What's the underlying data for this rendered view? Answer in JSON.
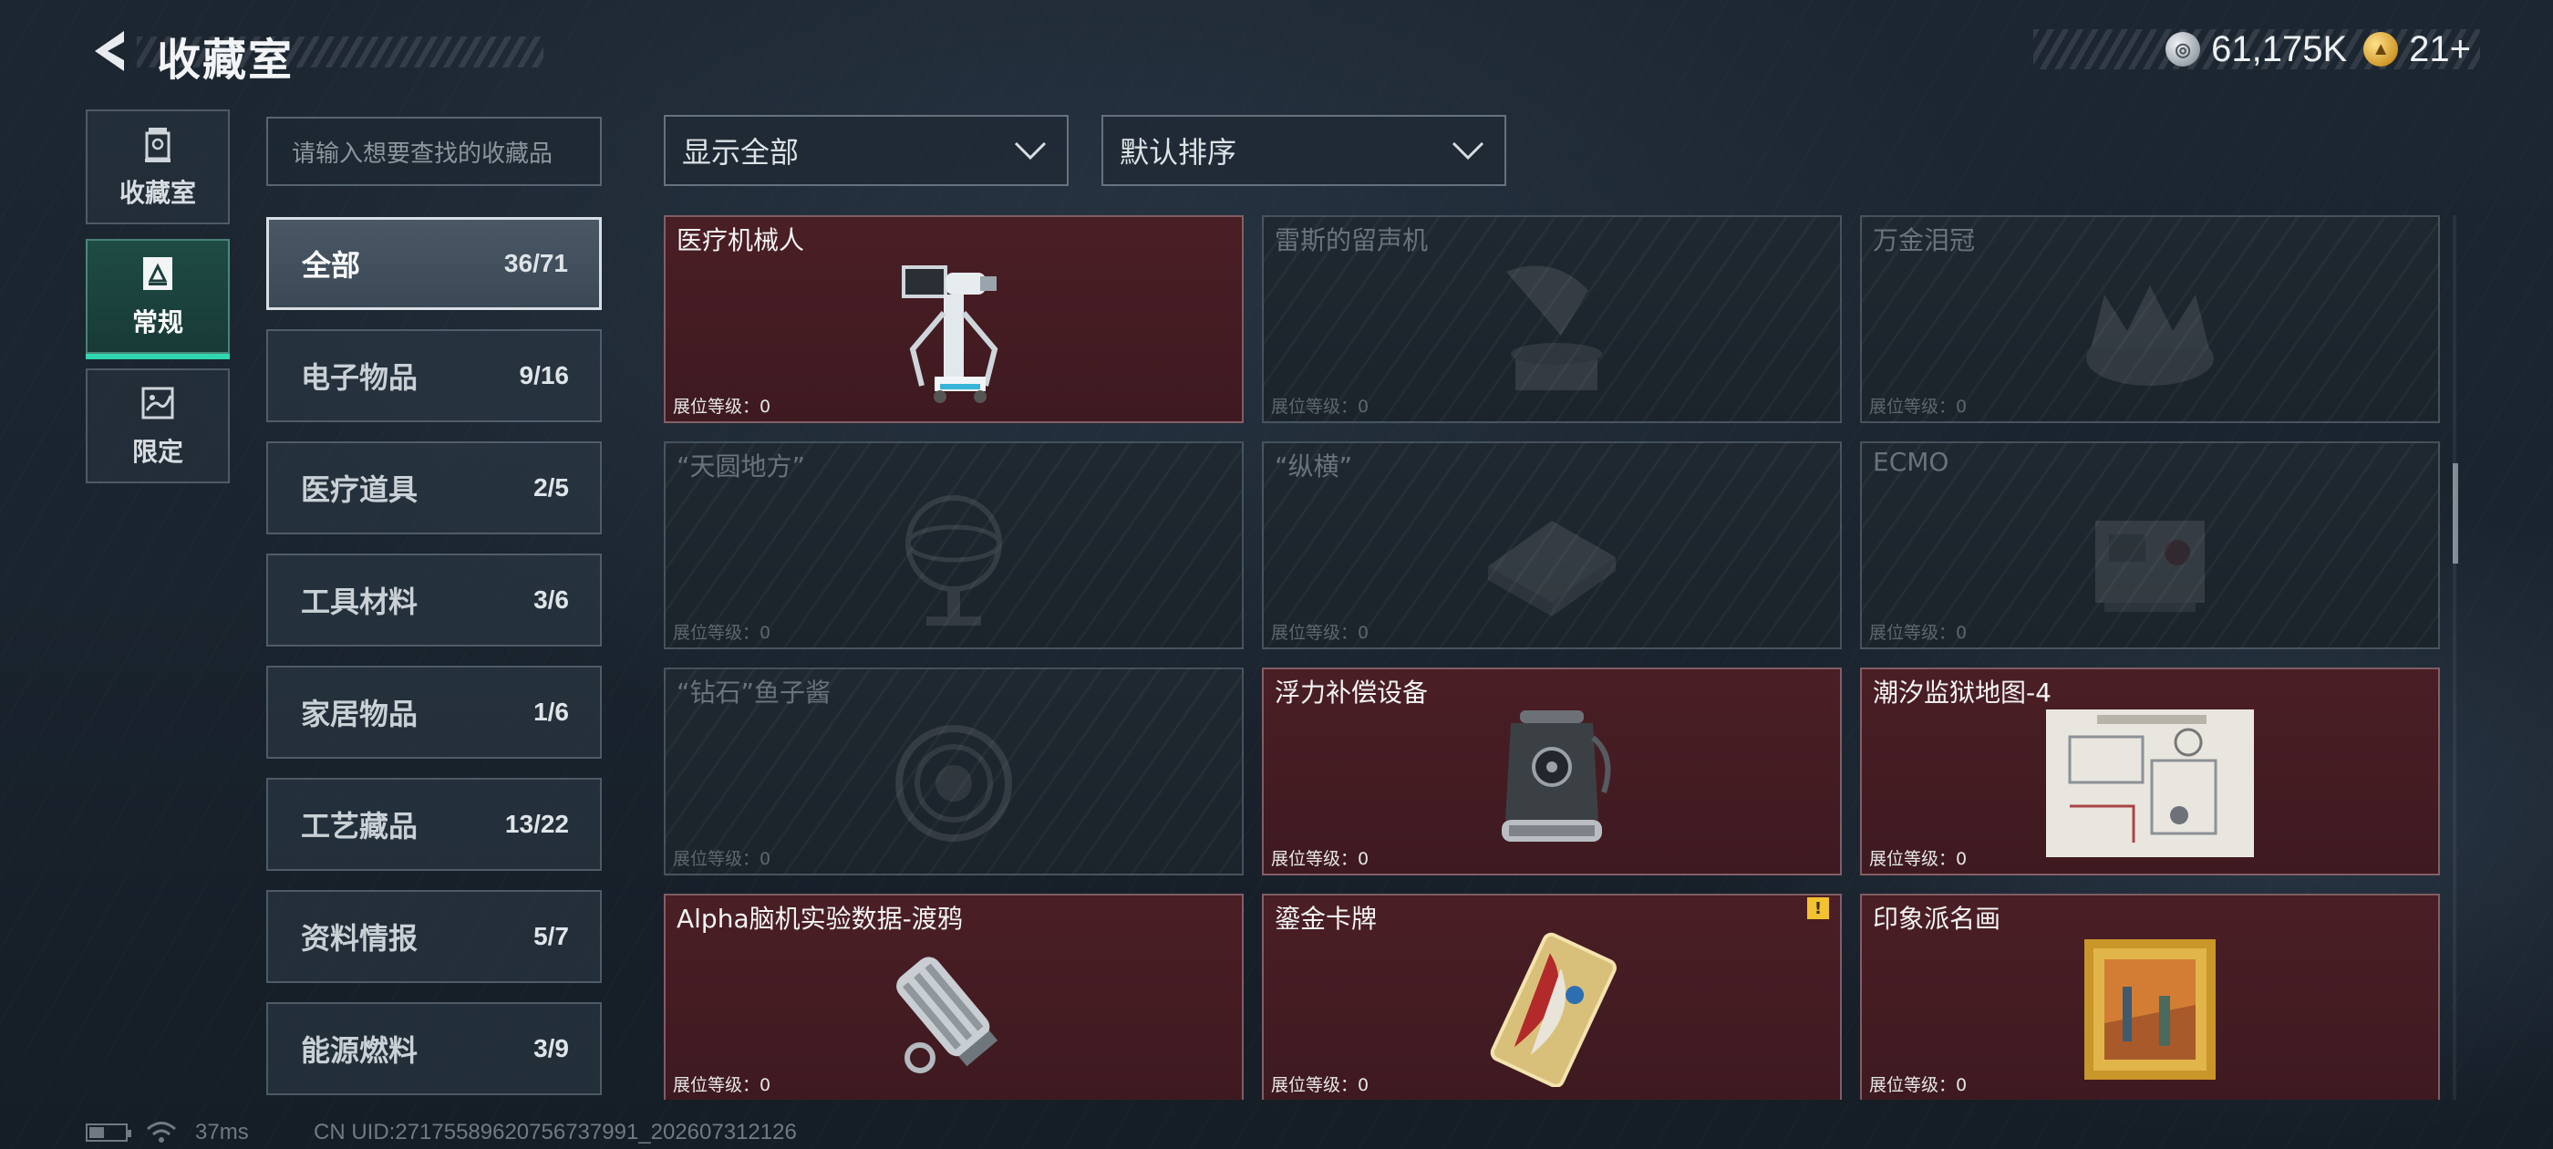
{
  "header": {
    "title": "收藏室",
    "currency": [
      {
        "icon": "silver-coin-icon",
        "value": "61,175K"
      },
      {
        "icon": "gold-coin-icon",
        "value": "21+"
      }
    ]
  },
  "side_tabs": [
    {
      "label": "收藏室",
      "icon": "collection-room-icon",
      "active": false
    },
    {
      "label": "常规",
      "icon": "regular-icon",
      "active": true
    },
    {
      "label": "限定",
      "icon": "limited-icon",
      "active": false
    }
  ],
  "search": {
    "placeholder": "请输入想要查找的收藏品"
  },
  "filters": {
    "show": "显示全部",
    "sort": "默认排序"
  },
  "categories": [
    {
      "name": "全部",
      "count": "36/71",
      "active": true
    },
    {
      "name": "电子物品",
      "count": "9/16"
    },
    {
      "name": "医疗道具",
      "count": "2/5"
    },
    {
      "name": "工具材料",
      "count": "3/6"
    },
    {
      "name": "家居物品",
      "count": "1/6"
    },
    {
      "name": "工艺藏品",
      "count": "13/22"
    },
    {
      "name": "资料情报",
      "count": "5/7"
    },
    {
      "name": "能源燃料",
      "count": "3/9"
    }
  ],
  "items": [
    {
      "name": "医疗机械人",
      "level": "展位等级：0",
      "owned": true,
      "icon": "medical-robot-icon"
    },
    {
      "name": "雷斯的留声机",
      "level": "展位等级：0",
      "owned": false,
      "icon": "gramophone-icon"
    },
    {
      "name": "万金泪冠",
      "level": "展位等级：0",
      "owned": false,
      "icon": "crown-icon"
    },
    {
      "name": "“天圆地方”",
      "level": "展位等级：0",
      "owned": false,
      "icon": "armillary-icon"
    },
    {
      "name": "“纵横”",
      "level": "展位等级：0",
      "owned": false,
      "icon": "chessboard-icon"
    },
    {
      "name": "ECMO",
      "level": "展位等级：0",
      "owned": false,
      "icon": "ecmo-machine-icon"
    },
    {
      "name": "“钻石”鱼子酱",
      "level": "展位等级：0",
      "owned": false,
      "icon": "caviar-tin-icon"
    },
    {
      "name": "浮力补偿设备",
      "level": "展位等级：0",
      "owned": true,
      "icon": "buoyancy-device-icon"
    },
    {
      "name": "潮汐监狱地图-4",
      "level": "展位等级：0",
      "owned": true,
      "icon": "prison-map-icon"
    },
    {
      "name": "Alpha脑机实验数据-渡鸦",
      "level": "展位等级：0",
      "owned": true,
      "icon": "data-canister-icon"
    },
    {
      "name": "鎏金卡牌",
      "level": "展位等级：0",
      "owned": true,
      "icon": "gilded-card-icon",
      "badge": "!"
    },
    {
      "name": "印象派名画",
      "level": "展位等级：0",
      "owned": true,
      "icon": "painting-icon"
    }
  ],
  "status": {
    "ping": "37ms",
    "uid": "CN UID:27175589620756737991_202607312126"
  }
}
